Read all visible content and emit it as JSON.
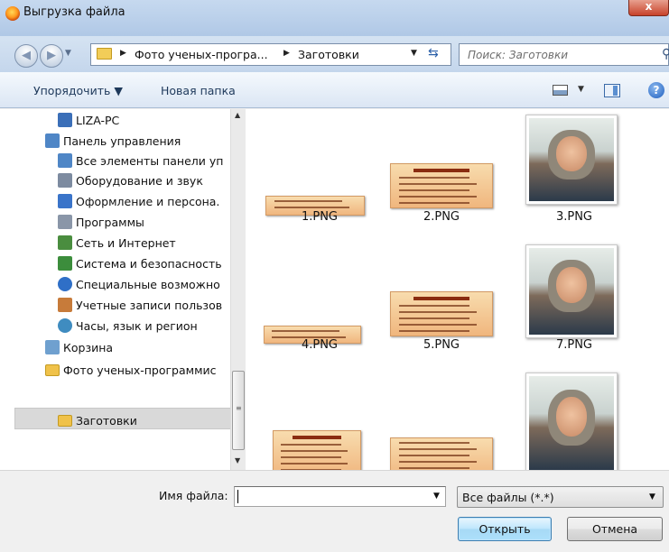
{
  "window": {
    "title": "Выгрузка файла",
    "close_glyph": "x"
  },
  "nav": {
    "breadcrumb": [
      "Фото ученых-програ...",
      "Заготовки"
    ],
    "search_placeholder": "Поиск: Заготовки"
  },
  "toolbar": {
    "organize_label": "Упорядочить ▼",
    "new_folder_label": "Новая папка"
  },
  "sidebar": {
    "items": [
      {
        "label": "LIZA-PC",
        "icon": "computer-icon",
        "color": "#3b6fb8"
      },
      {
        "label": "Панель управления",
        "icon": "control-panel-icon",
        "color": "#4f86c6"
      },
      {
        "label": "Все элементы панели уп",
        "icon": "control-panel-icon",
        "color": "#4f86c6"
      },
      {
        "label": "Оборудование и звук",
        "icon": "printer-icon",
        "color": "#7d8ba0"
      },
      {
        "label": "Оформление и персона.",
        "icon": "appearance-icon",
        "color": "#3a74c9"
      },
      {
        "label": "Программы",
        "icon": "programs-icon",
        "color": "#8a96a8"
      },
      {
        "label": "Сеть и Интернет",
        "icon": "network-icon",
        "color": "#4a8d3f"
      },
      {
        "label": "Система и безопасность",
        "icon": "shield-icon",
        "color": "#3c8d3c"
      },
      {
        "label": "Специальные возможно",
        "icon": "accessibility-icon",
        "color": "#2f6fc7"
      },
      {
        "label": "Учетные записи пользов",
        "icon": "users-icon",
        "color": "#c77b3a"
      },
      {
        "label": "Часы, язык и регион",
        "icon": "globe-icon",
        "color": "#3f8cc0"
      },
      {
        "label": "Корзина",
        "icon": "recycle-bin-icon",
        "color": "#6fa0cf"
      },
      {
        "label": "Фото ученых-программис",
        "icon": "folder-icon",
        "color": "#f0c24a"
      },
      {
        "label": "Заготовки",
        "icon": "folder-icon",
        "color": "#f0c24a"
      }
    ]
  },
  "files": [
    {
      "name": "1.PNG",
      "kind": "card"
    },
    {
      "name": "2.PNG",
      "kind": "card",
      "heading": "Уильям Генри Гейтс III"
    },
    {
      "name": "3.PNG",
      "kind": "photo"
    },
    {
      "name": "4.PNG",
      "kind": "card"
    },
    {
      "name": "5.PNG",
      "kind": "card",
      "heading": "Евгений Касперский"
    },
    {
      "name": "7.PNG",
      "kind": "photo"
    },
    {
      "name": "",
      "kind": "card",
      "heading": "Гради Буч"
    },
    {
      "name": "",
      "kind": "card"
    },
    {
      "name": "",
      "kind": "photo"
    }
  ],
  "bottom": {
    "filename_label": "Имя файла:",
    "filename_value": "",
    "filter_value": "Все файлы (*.*)",
    "open_label": "Открыть",
    "cancel_label": "Отмена"
  },
  "colors": {
    "selection": "#d9d9d9",
    "card_bg": "#f4c993",
    "accent": "#3c7fb1"
  }
}
